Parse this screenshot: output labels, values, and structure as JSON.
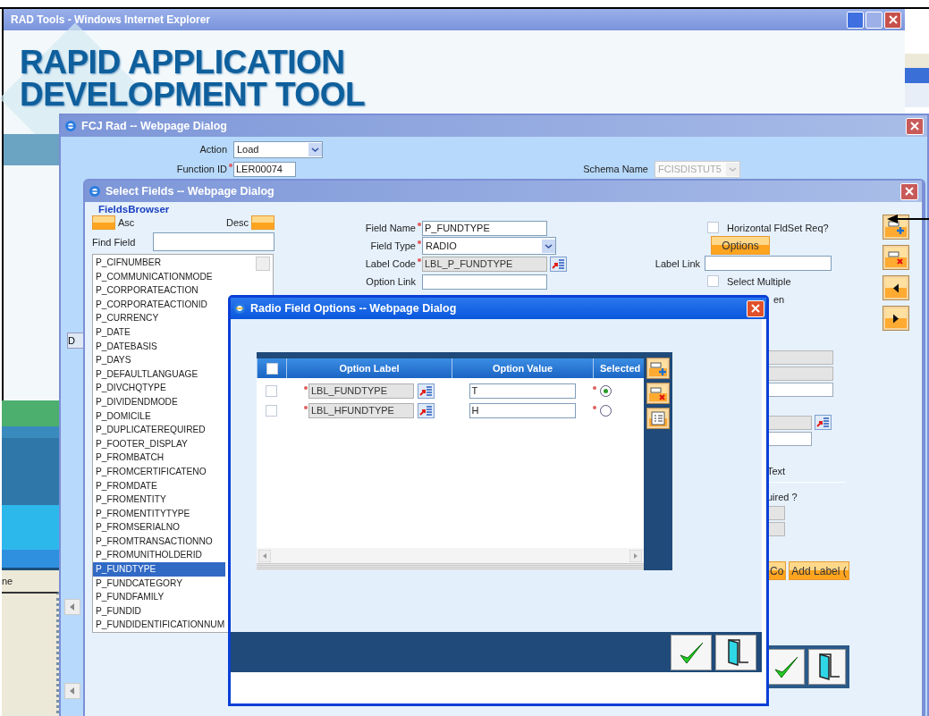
{
  "browser_window": {
    "title": "RAD Tools - Windows Internet Explorer",
    "logo": [
      "RAPID APPLICATION",
      "DEVELOPMENT TOOL"
    ],
    "status_text": "ne"
  },
  "fcj_dialog": {
    "title": "FCJ Rad -- Webpage Dialog",
    "tab": "D",
    "fields": [
      {
        "kind": "select",
        "label": "Action",
        "value": "Load",
        "required": false
      },
      {
        "kind": "text",
        "label": "Function ID",
        "value": "LER00074",
        "required": true
      },
      {
        "kind": "select",
        "label": "Schema Name",
        "value": "FCISDISTUT5",
        "required": false,
        "disabled": true
      }
    ]
  },
  "select_dialog": {
    "title": "Select Fields -- Webpage Dialog",
    "fields_browser": {
      "legend": "FieldsBrowser",
      "asc": "Asc",
      "desc": "Desc",
      "find_label": "Find Field",
      "items": [
        {
          "label": "P_CIFNUMBER",
          "selected": false
        },
        {
          "label": "P_COMMUNICATIONMODE",
          "selected": false
        },
        {
          "label": "P_CORPORATEACTION",
          "selected": false
        },
        {
          "label": "P_CORPORATEACTIONID",
          "selected": false
        },
        {
          "label": "P_CURRENCY",
          "selected": false
        },
        {
          "label": "P_DATE",
          "selected": false
        },
        {
          "label": "P_DATEBASIS",
          "selected": false
        },
        {
          "label": "P_DAYS",
          "selected": false
        },
        {
          "label": "P_DEFAULTLANGUAGE",
          "selected": false
        },
        {
          "label": "P_DIVCHQTYPE",
          "selected": false
        },
        {
          "label": "P_DIVIDENDMODE",
          "selected": false
        },
        {
          "label": "P_DOMICILE",
          "selected": false
        },
        {
          "label": "P_DUPLICATEREQUIRED",
          "selected": false
        },
        {
          "label": "P_FOOTER_DISPLAY",
          "selected": false
        },
        {
          "label": "P_FROMBATCH",
          "selected": false
        },
        {
          "label": "P_FROMCERTIFICATENO",
          "selected": false
        },
        {
          "label": "P_FROMDATE",
          "selected": false
        },
        {
          "label": "P_FROMENTITY",
          "selected": false
        },
        {
          "label": "P_FROMENTITYTYPE",
          "selected": false
        },
        {
          "label": "P_FROMSERIALNO",
          "selected": false
        },
        {
          "label": "P_FROMTRANSACTIONNO",
          "selected": false
        },
        {
          "label": "P_FROMUNITHOLDERID",
          "selected": false
        },
        {
          "label": "P_FUNDTYPE",
          "selected": true
        },
        {
          "label": "P_FUNDCATEGORY",
          "selected": false
        },
        {
          "label": "P_FUNDFAMILY",
          "selected": false
        },
        {
          "label": "P_FUNDID",
          "selected": false
        },
        {
          "label": "P_FUNDIDENTIFICATIONNUM",
          "selected": false
        }
      ]
    },
    "form": [
      {
        "kind": "text",
        "label": "Field Name",
        "value": "P_FUNDTYPE",
        "required": true
      },
      {
        "kind": "select",
        "label": "Field Type",
        "value": "RADIO",
        "required": true
      },
      {
        "kind": "lookup",
        "label": "Label Code",
        "value": "LBL_P_FUNDTYPE",
        "required": true
      },
      {
        "kind": "text",
        "label": "Option Link",
        "required": false
      }
    ],
    "options": [
      {
        "kind": "checkbox",
        "label": "Horizontal FldSet Req?",
        "checked": false
      },
      {
        "kind": "button",
        "label": "Options"
      },
      {
        "kind": "field",
        "label": "Label Link"
      },
      {
        "kind": "checkbox",
        "label": "Select Multiple",
        "checked": false
      },
      {
        "kind": "label",
        "label": "en"
      }
    ],
    "partial_labels": [
      "Text",
      "uired ?"
    ],
    "partial_buttons": [
      "Co",
      "Add Label ("
    ]
  },
  "radio_dialog": {
    "title": "Radio Field Options -- Webpage Dialog",
    "header_checked": false,
    "columns": [
      "Option Label",
      "Option Value",
      "Selected"
    ],
    "rows": [
      {
        "checked": false,
        "label": "LBL_FUNDTYPE",
        "value": "T",
        "selected": true
      },
      {
        "checked": false,
        "label": "LBL_HFUNDTYPE",
        "value": "H",
        "selected": false
      }
    ]
  }
}
